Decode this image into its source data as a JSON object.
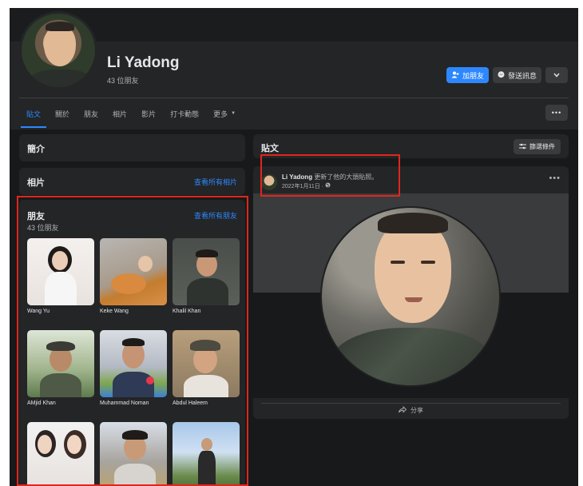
{
  "profile": {
    "name": "Li Yadong",
    "friend_count": "43 位朋友"
  },
  "actions": {
    "add_friend": "加朋友",
    "message": "發送訊息"
  },
  "tabs": [
    "貼文",
    "關於",
    "朋友",
    "相片",
    "影片",
    "打卡動態",
    "更多"
  ],
  "intro": {
    "title": "簡介"
  },
  "photos": {
    "title": "相片",
    "see_all": "查看所有相片"
  },
  "friends": {
    "title": "朋友",
    "count": "43 位朋友",
    "see_all": "查看所有朋友",
    "list": [
      {
        "name": "Wang Yu"
      },
      {
        "name": "Keke Wang"
      },
      {
        "name": "Khalil Khan"
      },
      {
        "name": "AMjid Khan"
      },
      {
        "name": "Muhammad Noman"
      },
      {
        "name": "Abdul Haleem"
      },
      {
        "name": ""
      },
      {
        "name": ""
      },
      {
        "name": ""
      }
    ]
  },
  "posts": {
    "title": "貼文",
    "filter": "篩選條件",
    "post": {
      "author": "Li Yadong",
      "action": "更新了他的大頭貼照。",
      "date": "2022年1月11日 · ",
      "share": "分享"
    }
  },
  "colors": {
    "background": "#18191a",
    "card": "#242526",
    "accent": "#2d88ff",
    "annotation": "#e0261d"
  }
}
